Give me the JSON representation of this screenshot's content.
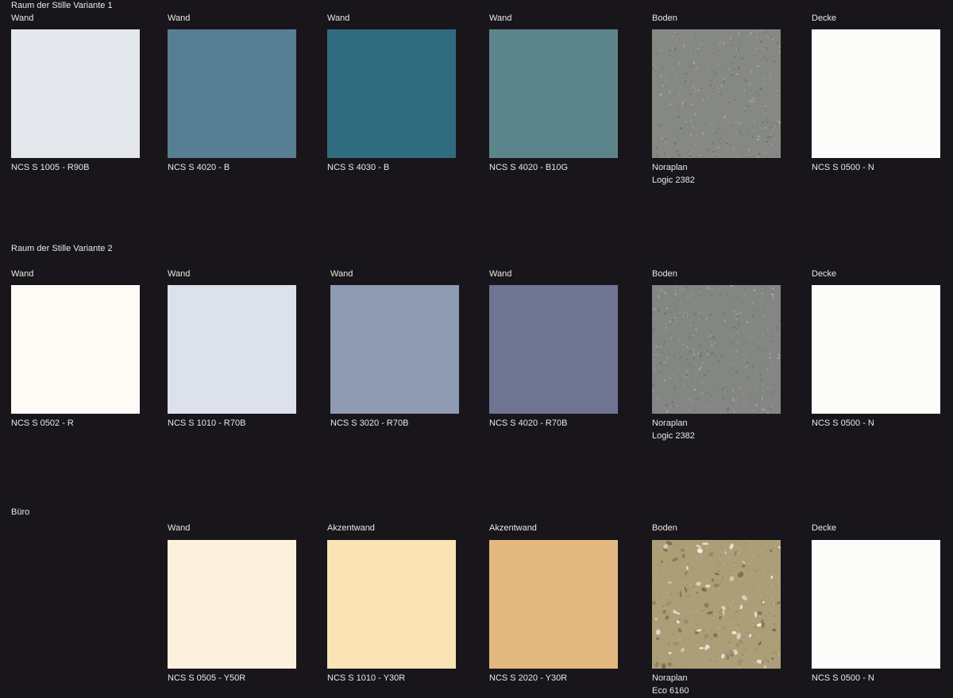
{
  "sections": [
    {
      "title": "Raum der Stille Variante 1",
      "items": [
        {
          "category": "Wand",
          "code": "NCS S 1005 - R90B",
          "color": "#e4e7ec",
          "texture": "plain"
        },
        {
          "category": "Wand",
          "code": "NCS S 4020 - B",
          "color": "#577e93",
          "texture": "plain"
        },
        {
          "category": "Wand",
          "code": "NCS S 4030 - B",
          "color": "#316b7f",
          "texture": "plain"
        },
        {
          "category": "Wand",
          "code": "NCS S 4020 - B10G",
          "color": "#5c858b",
          "texture": "plain"
        },
        {
          "category": "Boden",
          "code": "Noraplan",
          "code2": "Logic 2382",
          "color": "#868883",
          "texture": "speckle-grey"
        },
        {
          "category": "Decke",
          "code": "NCS S 0500 - N",
          "color": "#fcfcfa",
          "texture": "plain"
        }
      ]
    },
    {
      "title": "Raum der Stille Variante 2",
      "items": [
        {
          "category": "Wand",
          "code": "NCS S 0502 - R",
          "color": "#fefbf7",
          "texture": "plain"
        },
        {
          "category": "Wand",
          "code": "NCS S 1010 - R70B",
          "color": "#dce1ec",
          "texture": "plain"
        },
        {
          "category": "Wand",
          "code": "NCS S 3020 - R70B",
          "color": "#8f9ab3",
          "texture": "plain"
        },
        {
          "category": "Wand",
          "code": "NCS S 4020 - R70B",
          "color": "#6f7492",
          "texture": "plain"
        },
        {
          "category": "Boden",
          "code": "Noraplan",
          "code2": "Logic 2382",
          "color": "#838683",
          "texture": "speckle-grey"
        },
        {
          "category": "Decke",
          "code": "NCS S 0500 - N",
          "color": "#fcfcf9",
          "texture": "plain"
        }
      ]
    },
    {
      "title": "Büro",
      "items": [
        {
          "category": "Wand",
          "code": "NCS S 0505 - Y50R",
          "color": "#fdf1de",
          "texture": "plain"
        },
        {
          "category": "Akzentwand",
          "code": "NCS S 1010 - Y30R",
          "color": "#fae3b5",
          "texture": "plain"
        },
        {
          "category": "Akzentwand",
          "code": "NCS S 2020 - Y30R",
          "color": "#e2b880",
          "texture": "plain"
        },
        {
          "category": "Boden",
          "code": "Noraplan",
          "code2": "Eco 6160",
          "color": "#ac9f78",
          "texture": "speckle-beige"
        },
        {
          "category": "Decke",
          "code": "NCS S 0500 - N",
          "color": "#fcfcfa",
          "texture": "plain"
        }
      ]
    }
  ]
}
